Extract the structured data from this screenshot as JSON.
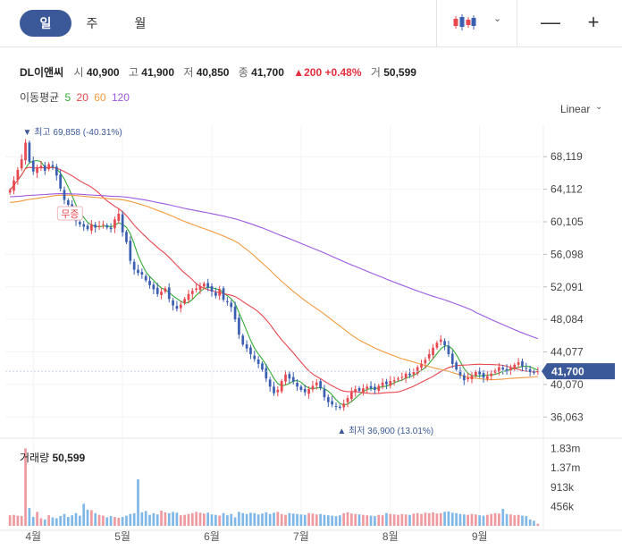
{
  "tabs": [
    {
      "label": "일",
      "active": true
    },
    {
      "label": "주",
      "active": false
    },
    {
      "label": "월",
      "active": false
    }
  ],
  "toolbar": {
    "chart_type_icon": "candlestick-icon",
    "chart_type_caret": "⌄",
    "zoom_out": "—",
    "zoom_in": "+"
  },
  "stock": {
    "name": "DL이앤씨",
    "open_label": "시",
    "open": "40,900",
    "high_label": "고",
    "high": "41,900",
    "low_label": "저",
    "low": "40,850",
    "close_label": "종",
    "close": "41,700",
    "change": "▲200",
    "change_pct": "+0.48%",
    "volume_label": "거",
    "volume": "50,599"
  },
  "moving_average": {
    "label": "이동평균",
    "periods": [
      {
        "label": "5",
        "color": "#33aa33"
      },
      {
        "label": "20",
        "color": "#e8474f"
      },
      {
        "label": "60",
        "color": "#f39a3c"
      },
      {
        "label": "120",
        "color": "#9b59e0"
      }
    ]
  },
  "scale": {
    "label": "Linear",
    "caret": "⌄"
  },
  "colors": {
    "up": "#e8474f",
    "down": "#3a5fb0",
    "accent": "#3b5998",
    "volume": "#7fb8e8",
    "volume_up": "#ef9aa0"
  },
  "chart_data": {
    "type": "candlestick",
    "ylim": [
      34000,
      72000
    ],
    "y_ticks": [
      "68,119",
      "64,112",
      "60,105",
      "56,098",
      "52,091",
      "48,084",
      "44,077",
      "40,070",
      "36,063"
    ],
    "y_tick_values": [
      68119,
      64112,
      60105,
      56098,
      52091,
      48084,
      44077,
      40070,
      36063
    ],
    "current_price_label": "41,700",
    "current_price": 41700,
    "x_labels": [
      "4월",
      "5월",
      "6월",
      "7월",
      "8월",
      "9월"
    ],
    "max_annotation": "최고 69,858 (-40.31%)",
    "min_annotation": "최저 36,900 (13.01%)",
    "dividend_marker": "무증",
    "volume_title_label": "거래량",
    "volume_title_value": "50,599",
    "volume_ticks": [
      "1.83m",
      "1.37m",
      "913k",
      "456k"
    ],
    "volume_tick_values": [
      1830000,
      1370000,
      913000,
      456000
    ],
    "closes": [
      64000,
      65200,
      66500,
      67800,
      69858,
      67500,
      66300,
      66800,
      67000,
      66400,
      67200,
      66900,
      65800,
      64200,
      62800,
      62200,
      61500,
      60200,
      59800,
      59500,
      59200,
      59800,
      59400,
      59600,
      59800,
      59400,
      59200,
      60400,
      61100,
      58800,
      57600,
      55300,
      54200,
      53800,
      53600,
      52900,
      52300,
      51800,
      51200,
      51500,
      51900,
      50600,
      49800,
      49400,
      49900,
      50600,
      51200,
      51600,
      51900,
      52200,
      52500,
      52000,
      51500,
      51000,
      51800,
      50500,
      50200,
      49600,
      48100,
      46200,
      45000,
      44500,
      43800,
      43200,
      42600,
      41900,
      40800,
      39800,
      39000,
      39400,
      40500,
      41300,
      40800,
      40400,
      39800,
      39400,
      39100,
      39500,
      39900,
      40300,
      39600,
      38500,
      37900,
      37600,
      37400,
      37200,
      37700,
      38400,
      39100,
      39500,
      39300,
      39600,
      39800,
      39600,
      39400,
      39900,
      40300,
      40100,
      40500,
      40600,
      40800,
      41000,
      41400,
      41200,
      41600,
      42200,
      42600,
      43100,
      43800,
      44600,
      45200,
      45600,
      44900,
      43800,
      42600,
      41900,
      41200,
      40600,
      40900,
      41200,
      41600,
      41300,
      40900,
      41100,
      41400,
      41800,
      42200,
      41900,
      41600,
      42100,
      42500,
      42800,
      42300,
      42000,
      41600,
      41500,
      41700
    ],
    "volumes": [
      250000,
      260000,
      240000,
      230000,
      1830000,
      420000,
      210000,
      330000,
      180000,
      150000,
      250000,
      200000,
      180000,
      230000,
      280000,
      210000,
      250000,
      300000,
      240000,
      520000,
      380000,
      370000,
      300000,
      260000,
      240000,
      200000,
      230000,
      210000,
      190000,
      210000,
      240000,
      280000,
      300000,
      1100000,
      320000,
      350000,
      260000,
      300000,
      270000,
      360000,
      320000,
      300000,
      330000,
      310000,
      250000,
      260000,
      280000,
      300000,
      330000,
      310000,
      290000,
      310000,
      270000,
      260000,
      240000,
      300000,
      250000,
      280000,
      200000,
      330000,
      300000,
      280000,
      310000,
      300000,
      270000,
      290000,
      320000,
      280000,
      310000,
      330000,
      280000,
      260000,
      300000,
      290000,
      280000,
      270000,
      260000,
      300000,
      290000,
      270000,
      280000,
      260000,
      250000,
      240000,
      230000,
      250000,
      300000,
      320000,
      290000,
      280000,
      270000,
      260000,
      250000,
      240000,
      230000,
      260000,
      250000,
      300000,
      280000,
      270000,
      260000,
      280000,
      270000,
      260000,
      290000,
      300000,
      280000,
      310000,
      300000,
      320000,
      290000,
      300000,
      330000,
      340000,
      310000,
      300000,
      280000,
      270000,
      260000,
      280000,
      270000,
      250000,
      240000,
      260000,
      280000,
      300000,
      290000,
      400000,
      280000,
      270000,
      250000,
      260000,
      240000,
      230000,
      150000,
      120000,
      50599
    ]
  }
}
